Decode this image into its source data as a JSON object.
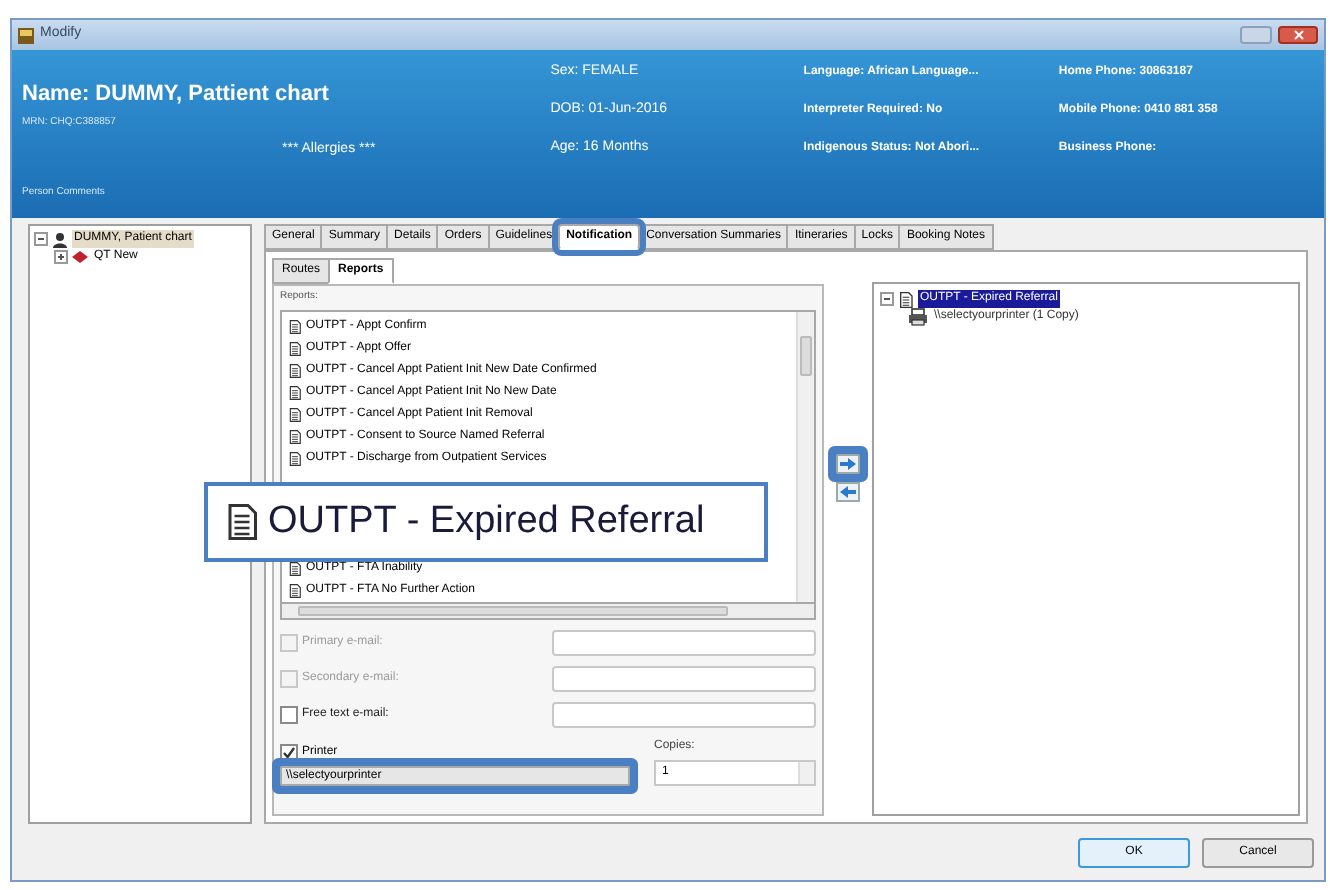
{
  "window": {
    "title": "Modify"
  },
  "header": {
    "name": "Name: DUMMY, Pattient chart",
    "mrn": "MRN: CHQ:C388857",
    "allergies": "*** Allergies ***",
    "comments": "Person Comments",
    "columns": [
      [
        "Sex: FEMALE",
        "DOB: 01-Jun-2016",
        "Age: 16 Months"
      ],
      [
        "Language: African Language...",
        "Interpreter Required: No",
        "Indigenous Status: Not Abori..."
      ],
      [
        "Home Phone: 30863187",
        "Mobile Phone: 0410 881 358",
        "Business Phone:"
      ]
    ]
  },
  "tree": [
    {
      "label": "DUMMY, Patient chart",
      "expanded": true,
      "selected": true,
      "children": [
        {
          "label": "QT New",
          "expanded": false,
          "selected": false
        }
      ]
    }
  ],
  "tabs": [
    {
      "label": "General",
      "selected": false,
      "highlighted": false
    },
    {
      "label": "Summary",
      "selected": false,
      "highlighted": false
    },
    {
      "label": "Details",
      "selected": false,
      "highlighted": false
    },
    {
      "label": "Orders",
      "selected": false,
      "highlighted": false
    },
    {
      "label": "Guidelines",
      "selected": false,
      "highlighted": false
    },
    {
      "label": "Notification",
      "selected": true,
      "highlighted": true
    },
    {
      "label": "Conversation Summaries",
      "selected": false,
      "highlighted": false
    },
    {
      "label": "Itineraries",
      "selected": false,
      "highlighted": false
    },
    {
      "label": "Locks",
      "selected": false,
      "highlighted": false
    },
    {
      "label": "Booking Notes",
      "selected": false,
      "highlighted": false
    }
  ],
  "subtabs": [
    {
      "label": "Routes",
      "selected": false
    },
    {
      "label": "Reports",
      "selected": true
    }
  ],
  "reports": {
    "label": "Reports:",
    "items": [
      {
        "label": "OUTPT - Appt Confirm"
      },
      {
        "label": "OUTPT - Appt Offer"
      },
      {
        "label": "OUTPT - Cancel Appt Patient Init New Date Confirmed"
      },
      {
        "label": "OUTPT - Cancel Appt Patient Init No New Date"
      },
      {
        "label": "OUTPT - Cancel Appt Patient Init Removal"
      },
      {
        "label": "OUTPT - Consent to Source Named Referral"
      },
      {
        "label": "OUTPT - Discharge from Outpatient Services"
      }
    ],
    "items_after": [
      {
        "label": "OUTPT - FTA Inability"
      },
      {
        "label": "OUTPT - FTA No Further Action"
      }
    ]
  },
  "email_options": [
    {
      "label": "Primary e-mail:",
      "checked": false,
      "disabled": true
    },
    {
      "label": "Secondary e-mail:",
      "checked": false,
      "disabled": true
    },
    {
      "label": "Free text e-mail:",
      "checked": false,
      "disabled": false
    }
  ],
  "printer": {
    "label": "Printer",
    "checked": true,
    "value": "\\\\selectyourprinter",
    "highlighted": true
  },
  "copies": {
    "label": "Copies:",
    "value": "1"
  },
  "transfer_buttons": [
    {
      "kind": "add",
      "highlighted": true
    },
    {
      "kind": "remove",
      "highlighted": false
    }
  ],
  "selected_tree": [
    {
      "label": "OUTPT - Expired Referral",
      "selected": true,
      "children": [
        {
          "label": "\\\\selectyourprinter (1 Copy)",
          "selected": false
        }
      ]
    }
  ],
  "buttons": [
    {
      "label": "OK",
      "default": true
    },
    {
      "label": "Cancel",
      "default": false
    }
  ],
  "callout": {
    "text": "OUTPT - Expired Referral"
  }
}
